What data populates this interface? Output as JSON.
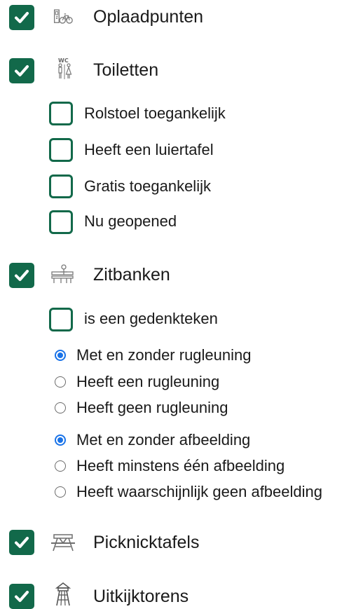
{
  "colors": {
    "accent": "#12694a",
    "radio_selected": "#1a73e8"
  },
  "layers": {
    "charging": {
      "label": "Oplaadpunten",
      "icon": "bicycle-charging-icon",
      "checked": true
    },
    "toilets": {
      "label": "Toiletten",
      "icon": "wc-icon",
      "checked": true,
      "filters": [
        {
          "label": "Rolstoel toegankelijk",
          "checked": false
        },
        {
          "label": "Heeft een luiertafel",
          "checked": false
        },
        {
          "label": "Gratis toegankelijk",
          "checked": false
        },
        {
          "label": "Nu geopened",
          "checked": false
        }
      ]
    },
    "benches": {
      "label": "Zitbanken",
      "icon": "bench-icon",
      "checked": true,
      "filters": [
        {
          "label": "is een gedenkteken",
          "checked": false
        }
      ],
      "backrest_options": [
        {
          "label": "Met en zonder rugleuning",
          "selected": true
        },
        {
          "label": "Heeft een rugleuning",
          "selected": false
        },
        {
          "label": "Heeft geen rugleuning",
          "selected": false
        }
      ],
      "image_options": [
        {
          "label": "Met en zonder afbeelding",
          "selected": true
        },
        {
          "label": "Heeft minstens één afbeelding",
          "selected": false
        },
        {
          "label": "Heeft waarschijnlijk geen afbeelding",
          "selected": false
        }
      ]
    },
    "picnic": {
      "label": "Picknicktafels",
      "icon": "picnic-table-icon",
      "checked": true
    },
    "towers": {
      "label": "Uitkijktorens",
      "icon": "watchtower-icon",
      "checked": true
    }
  }
}
